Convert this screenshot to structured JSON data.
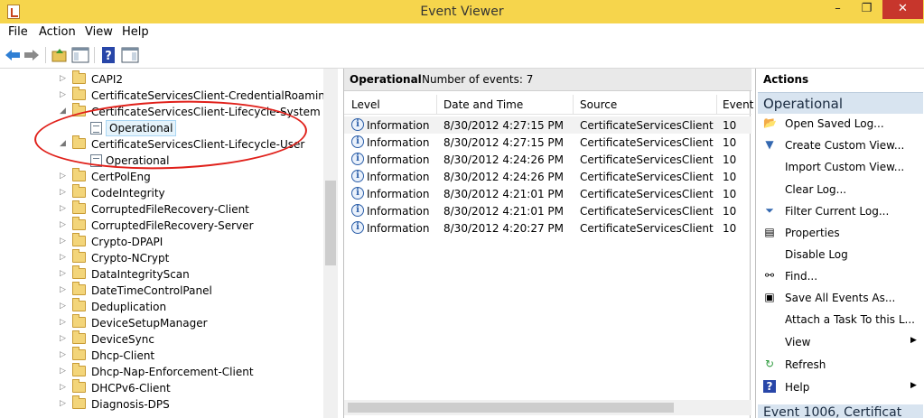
{
  "window": {
    "title": "Event Viewer",
    "minimize": "–",
    "maximize": "❐",
    "close": "✕"
  },
  "menu": [
    "File",
    "Action",
    "View",
    "Help"
  ],
  "tree": {
    "items": [
      {
        "label": "CAPI2",
        "type": "folder",
        "expanded": false
      },
      {
        "label": "CertificateServicesClient-CredentialRoaming",
        "type": "folder",
        "expanded": false
      },
      {
        "label": "CertificateServicesClient-Lifecycle-System",
        "type": "folder",
        "expanded": true
      },
      {
        "label": "Operational",
        "type": "log",
        "selected": true
      },
      {
        "label": "CertificateServicesClient-Lifecycle-User",
        "type": "folder",
        "expanded": true
      },
      {
        "label": "Operational",
        "type": "log"
      },
      {
        "label": "CertPolEng",
        "type": "folder",
        "expanded": false
      },
      {
        "label": "CodeIntegrity",
        "type": "folder",
        "expanded": false
      },
      {
        "label": "CorruptedFileRecovery-Client",
        "type": "folder",
        "expanded": false
      },
      {
        "label": "CorruptedFileRecovery-Server",
        "type": "folder",
        "expanded": false
      },
      {
        "label": "Crypto-DPAPI",
        "type": "folder",
        "expanded": false
      },
      {
        "label": "Crypto-NCrypt",
        "type": "folder",
        "expanded": false
      },
      {
        "label": "DataIntegrityScan",
        "type": "folder",
        "expanded": false
      },
      {
        "label": "DateTimeControlPanel",
        "type": "folder",
        "expanded": false
      },
      {
        "label": "Deduplication",
        "type": "folder",
        "expanded": false
      },
      {
        "label": "DeviceSetupManager",
        "type": "folder",
        "expanded": false
      },
      {
        "label": "DeviceSync",
        "type": "folder",
        "expanded": false
      },
      {
        "label": "Dhcp-Client",
        "type": "folder",
        "expanded": false
      },
      {
        "label": "Dhcp-Nap-Enforcement-Client",
        "type": "folder",
        "expanded": false
      },
      {
        "label": "DHCPv6-Client",
        "type": "folder",
        "expanded": false
      },
      {
        "label": "Diagnosis-DPS",
        "type": "folder",
        "expanded": false
      }
    ]
  },
  "center": {
    "title": "Operational",
    "count": "Number of events: 7",
    "columns": [
      "Level",
      "Date and Time",
      "Source",
      "Event"
    ],
    "rows": [
      {
        "level": "Information",
        "date": "8/30/2012 4:27:15 PM",
        "source": "CertificateServicesClient...",
        "event": "10"
      },
      {
        "level": "Information",
        "date": "8/30/2012 4:27:15 PM",
        "source": "CertificateServicesClient...",
        "event": "10"
      },
      {
        "level": "Information",
        "date": "8/30/2012 4:24:26 PM",
        "source": "CertificateServicesClient...",
        "event": "10"
      },
      {
        "level": "Information",
        "date": "8/30/2012 4:24:26 PM",
        "source": "CertificateServicesClient...",
        "event": "10"
      },
      {
        "level": "Information",
        "date": "8/30/2012 4:21:01 PM",
        "source": "CertificateServicesClient...",
        "event": "10"
      },
      {
        "level": "Information",
        "date": "8/30/2012 4:21:01 PM",
        "source": "CertificateServicesClient...",
        "event": "10"
      },
      {
        "level": "Information",
        "date": "8/30/2012 4:20:27 PM",
        "source": "CertificateServicesClient...",
        "event": "10"
      }
    ]
  },
  "actions": {
    "header": "Actions",
    "group": "Operational",
    "items": [
      {
        "label": "Open Saved Log...",
        "icon": "open-folder-icon"
      },
      {
        "label": "Create Custom View...",
        "icon": "funnel-icon"
      },
      {
        "label": "Import Custom View...",
        "icon": ""
      },
      {
        "label": "Clear Log...",
        "icon": ""
      },
      {
        "label": "Filter Current Log...",
        "icon": "filter-icon"
      },
      {
        "label": "Properties",
        "icon": "properties-icon"
      },
      {
        "label": "Disable Log",
        "icon": ""
      },
      {
        "label": "Find...",
        "icon": "binoculars-icon"
      },
      {
        "label": "Save All Events As...",
        "icon": "save-icon"
      },
      {
        "label": "Attach a Task To this L...",
        "icon": ""
      },
      {
        "label": "View",
        "icon": "",
        "submenu": true
      },
      {
        "label": "Refresh",
        "icon": "refresh-icon"
      },
      {
        "label": "Help",
        "icon": "help-icon",
        "submenu": true
      }
    ],
    "group2": "Event 1006, Certificat"
  },
  "colors": {
    "titlebar": "#f6d54c",
    "close": "#c7362c",
    "annotation": "#e0201a",
    "selection": "#e5f3fb"
  }
}
